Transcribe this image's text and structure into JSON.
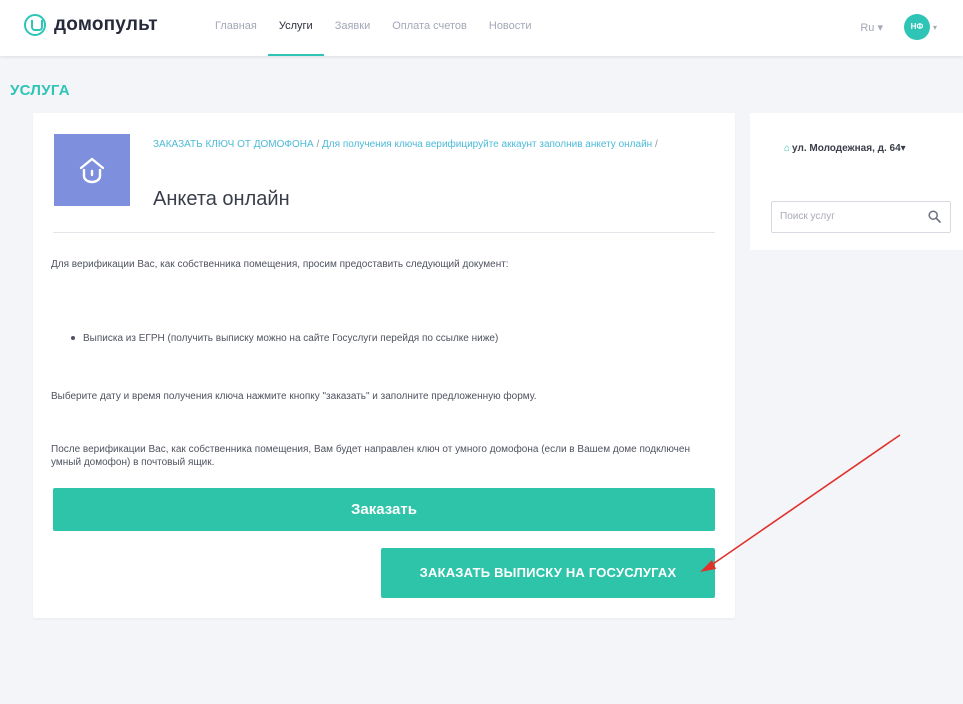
{
  "header": {
    "logo_text": "домопульт",
    "nav": [
      {
        "label": "Главная",
        "active": false
      },
      {
        "label": "Услуги",
        "active": true
      },
      {
        "label": "Заявки",
        "active": false
      },
      {
        "label": "Оплата счетов",
        "active": false
      },
      {
        "label": "Новости",
        "active": false
      }
    ],
    "lang": "Ru ▾",
    "avatar_initials": "НФ",
    "accent_color": "#2ec4b6"
  },
  "page": {
    "section_title": "УСЛУГА"
  },
  "service": {
    "icon": "home-security-icon",
    "icon_bg": "#7d8fdd",
    "breadcrumb": {
      "part1": "ЗАКАЗАТЬ КЛЮЧ ОТ ДОМОФОНА",
      "sep1": " / ",
      "part2": "Для получения ключа верифицируйте аккаунт заполнив анкету онлайн",
      "sep2": " /"
    },
    "title": "Анкета онлайн",
    "intro": "Для верификации Вас, как собственника помещения, просим предоставить  следующий документ:",
    "bullet": "Выписка из ЕГРН (получить выписку можно на сайте Госуслуги перейдя по ссылке ниже)",
    "para2": "Выберите дату и время получения ключа нажмите кнопку \"заказать\" и заполните предложенную форму.",
    "para3": "После верификации Вас, как собственника помещения, Вам будет направлен ключ от умного домофона (если в Вашем доме подключен умный домофон) в почтовый ящик.",
    "order_button": "Заказать",
    "gos_button": "ЗАКАЗАТЬ ВЫПИСКУ НА ГОСУСЛУГАХ",
    "button_color": "#2ec4a9"
  },
  "sidebar": {
    "address": "ул. Молодежная, д. 64",
    "address_caret": "▾",
    "search_placeholder": "Поиск услуг"
  },
  "annotation": {
    "arrow_color": "#e0322c"
  }
}
